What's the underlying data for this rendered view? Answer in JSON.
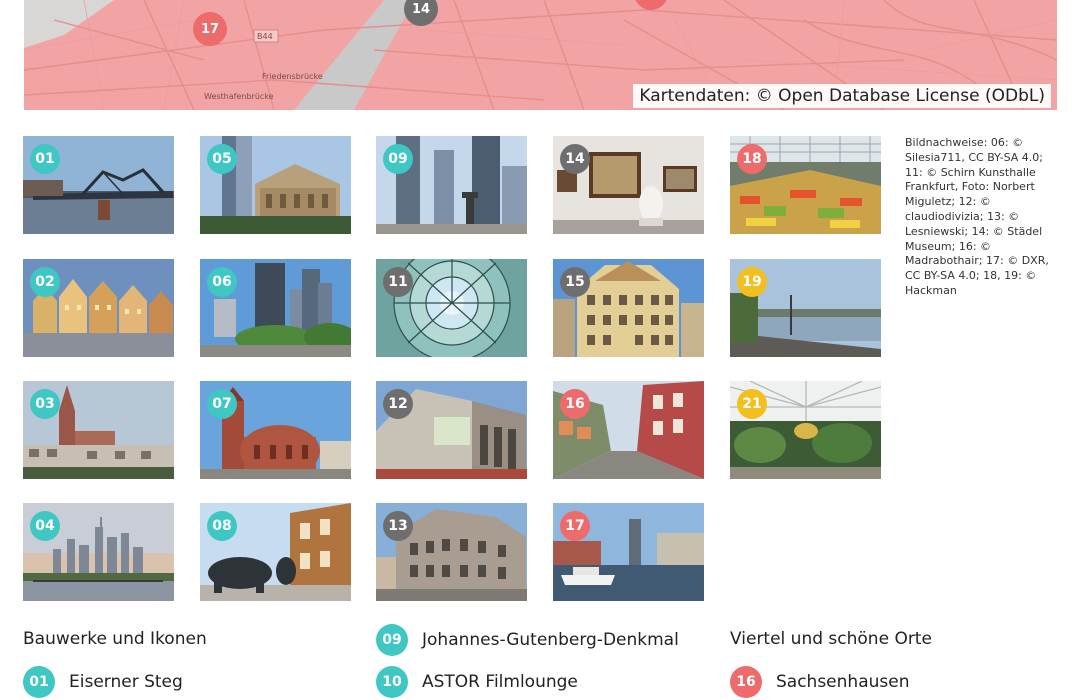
{
  "colors": {
    "teal": "#3fc7c3",
    "gray": "#6e6e6e",
    "coral": "#ee6b6b",
    "yellow": "#f2bf1f",
    "map_fill": "#f2a4a4"
  },
  "map": {
    "credit": "Kartendaten: © Open Database License (ODbL)",
    "street_labels": [
      "Friedensbrücke",
      "Westhafenbrücke",
      "B44"
    ],
    "markers": [
      "17",
      "14"
    ]
  },
  "photos": {
    "p01": {
      "number": "01",
      "scene": "iron-footbridge"
    },
    "p05": {
      "number": "05",
      "scene": "old-opera"
    },
    "p09": {
      "number": "09",
      "scene": "skyscrapers-monument"
    },
    "p14": {
      "number": "14",
      "scene": "museum-gallery"
    },
    "p18": {
      "number": "18",
      "scene": "market-hall"
    },
    "p02": {
      "number": "02",
      "scene": "roemer-houses"
    },
    "p06": {
      "number": "06",
      "scene": "skyline-park"
    },
    "p11": {
      "number": "11",
      "scene": "glass-dome"
    },
    "p15": {
      "number": "15",
      "scene": "goethe-house"
    },
    "p19": {
      "number": "19",
      "scene": "riverbank"
    },
    "p03": {
      "number": "03",
      "scene": "cathedral"
    },
    "p07": {
      "number": "07",
      "scene": "paulskirche"
    },
    "p12": {
      "number": "12",
      "scene": "modern-building"
    },
    "p16": {
      "number": "16",
      "scene": "cobbled-lane"
    },
    "p21": {
      "number": "21",
      "scene": "palm-garden"
    },
    "p04": {
      "number": "04",
      "scene": "skyline-river"
    },
    "p08": {
      "number": "08",
      "scene": "bull-and-bear"
    },
    "p13": {
      "number": "13",
      "scene": "old-building"
    },
    "p17": {
      "number": "17",
      "scene": "harbour"
    }
  },
  "credits": "Bildnachweise: 06: © Silesia711, CC BY-SA 4.0; 11: © Schirn Kunsthalle Frankfurt, Foto: Norbert Miguletz; 12: © claudiodivizia; 13: © Lesniewski; 14: © Städel Museum; 16: © Madrabothair; 17: © DXR, CC BY-SA 4.0; 18, 19: © Hackman",
  "legend": {
    "categories": {
      "bauwerke": "Bauwerke und Ikonen",
      "viertel": "Viertel und schöne Orte"
    },
    "items": [
      {
        "number": "01",
        "label": "Eiserner Steg"
      },
      {
        "number": "09",
        "label": "Johannes-Gutenberg-Denkmal"
      },
      {
        "number": "10",
        "label": "ASTOR Filmlounge"
      },
      {
        "number": "16",
        "label": "Sachsenhausen"
      }
    ]
  }
}
